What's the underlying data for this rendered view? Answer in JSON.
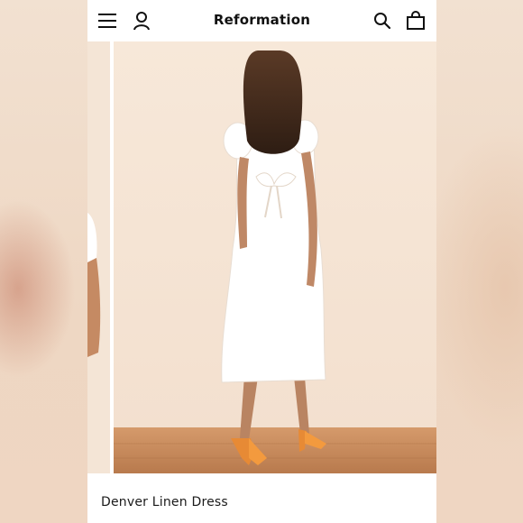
{
  "header": {
    "brand": "Reformation",
    "icons": [
      "menu-icon",
      "account-icon",
      "search-icon",
      "shopping-bag-icon"
    ]
  },
  "gallery": {
    "image_subject": "white linen midi dress with open tie back, orange sandals"
  },
  "product": {
    "title": "Denver Linen Dress"
  },
  "colors": {
    "background": "#ffffff",
    "text": "#111111",
    "photo_wall": "#f6e6d6",
    "floor": "#c98a5c"
  }
}
